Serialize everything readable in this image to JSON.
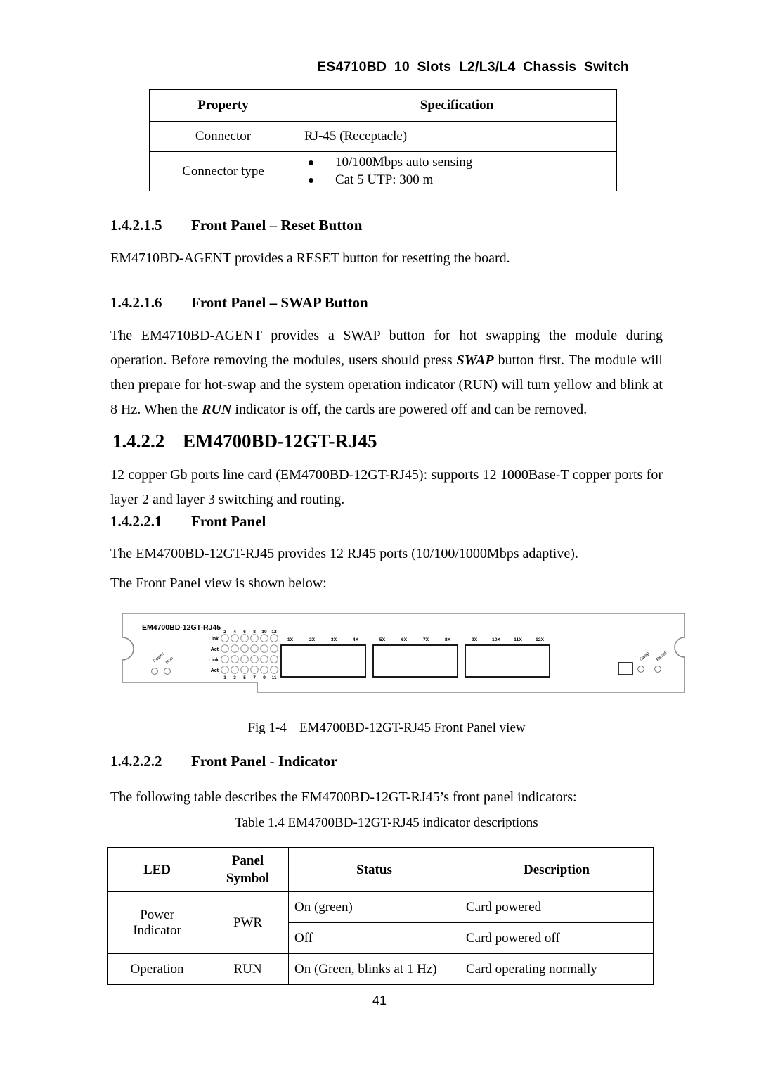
{
  "header": {
    "title": "ES4710BD 10 Slots L2/L3/L4 Chassis Switch"
  },
  "spec_table": {
    "columns": [
      "Property",
      "Specification"
    ],
    "rows": [
      {
        "property": "Connector",
        "value": "RJ-45 (Receptacle)"
      },
      {
        "property": "Connector type",
        "bullets": [
          "10/100Mbps auto sensing",
          "Cat 5 UTP: 300 m"
        ]
      }
    ]
  },
  "sections": {
    "reset_button": {
      "number": "1.4.2.1.5",
      "title": "Front Panel – Reset Button",
      "body": "EM4710BD-AGENT provides a RESET button for resetting the board."
    },
    "swap_button": {
      "number": "1.4.2.1.6",
      "title": "Front Panel – SWAP Button",
      "body_part1": "The EM4710BD-AGENT provides a SWAP button for hot swapping the module during operation. Before removing the modules, users should press ",
      "body_em1": "SWAP",
      "body_part2": " button first. The module will then prepare for hot-swap and the system operation indicator (RUN) will turn yellow and blink at 8 Hz. When the ",
      "body_em2": "RUN",
      "body_part3": " indicator is off, the cards are powered off and can be removed."
    },
    "module": {
      "number": "1.4.2.2",
      "title": "EM4700BD-12GT-RJ45",
      "body": "12 copper Gb ports line card (EM4700BD-12GT-RJ45): supports 12 1000Base-T copper ports for layer 2 and layer 3 switching and routing."
    },
    "front_panel": {
      "number": "1.4.2.2.1",
      "title": "Front Panel",
      "body1": "The EM4700BD-12GT-RJ45 provides 12 RJ45 ports (10/100/1000Mbps adaptive).",
      "body2": "The Front Panel view is shown below:"
    },
    "front_panel_indicator": {
      "number": "1.4.2.2.2",
      "title": "Front Panel - Indicator",
      "body": "The following table describes the EM4700BD-12GT-RJ45’s front panel indicators:",
      "table_caption": "Table 1.4 EM4700BD-12GT-RJ45 indicator descriptions"
    }
  },
  "figure": {
    "caption_label": "Fig 1-4",
    "caption_text": "EM4700BD-12GT-RJ45 Front Panel view",
    "panel": {
      "model_label": "EM4700BD-12GT-RJ45",
      "left_leds": [
        "Power",
        "Run"
      ],
      "right_buttons": [
        "Swap",
        "Reset"
      ],
      "led_row_labels": [
        "Link",
        "Act",
        "Link",
        "Act"
      ],
      "led_top_numbers": [
        "2",
        "4",
        "6",
        "8",
        "10",
        "12"
      ],
      "led_bottom_numbers": [
        "1",
        "3",
        "5",
        "7",
        "9",
        "11"
      ],
      "port_groups": [
        [
          "1X",
          "2X",
          "3X",
          "4X"
        ],
        [
          "5X",
          "6X",
          "7X",
          "8X"
        ],
        [
          "9X",
          "10X",
          "11X",
          "12X"
        ]
      ]
    }
  },
  "indicator_table": {
    "columns": [
      "LED",
      "Panel Symbol",
      "Status",
      "Description"
    ],
    "column_led": "LED",
    "column_panel": "Panel",
    "column_symbol": "Symbol",
    "column_status": "Status",
    "column_description": "Description",
    "rows": [
      {
        "led": "Power Indicator",
        "led_line1": "Power",
        "led_line2": "Indicator",
        "symbol": "PWR",
        "status": "On (green)",
        "description": "Card powered"
      },
      {
        "led": "",
        "symbol": "",
        "status": "Off",
        "description": "Card powered off"
      },
      {
        "led": "Operation",
        "symbol": "RUN",
        "status": "On (Green, blinks at 1 Hz)",
        "description": "Card operating normally"
      }
    ]
  },
  "footer": {
    "page_number": "41"
  }
}
